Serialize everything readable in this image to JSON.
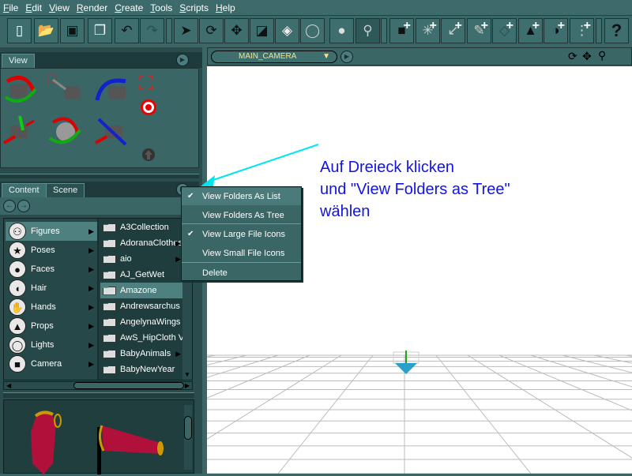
{
  "menubar": [
    "File",
    "Edit",
    "View",
    "Render",
    "Create",
    "Tools",
    "Scripts",
    "Help"
  ],
  "view_panel": {
    "tab": "View"
  },
  "content_panel": {
    "tabs": [
      "Content",
      "Scene"
    ],
    "categories": [
      {
        "label": "Figures",
        "icon": "figure-icon",
        "selected": true
      },
      {
        "label": "Poses",
        "icon": "pose-icon"
      },
      {
        "label": "Faces",
        "icon": "face-icon"
      },
      {
        "label": "Hair",
        "icon": "hair-icon"
      },
      {
        "label": "Hands",
        "icon": "hand-icon"
      },
      {
        "label": "Props",
        "icon": "props-icon"
      },
      {
        "label": "Lights",
        "icon": "lightbulb-icon"
      },
      {
        "label": "Camera",
        "icon": "camera-icon"
      }
    ],
    "folders": [
      {
        "label": "A3Collection",
        "sub": false
      },
      {
        "label": "AdoranaClothes",
        "sub": true
      },
      {
        "label": "aio",
        "sub": true
      },
      {
        "label": "AJ_GetWet",
        "sub": false
      },
      {
        "label": "Amazone",
        "sub": false,
        "selected": true
      },
      {
        "label": "Andrewsarchus",
        "sub": false
      },
      {
        "label": "AngelynaWings",
        "sub": false
      },
      {
        "label": "AwS_HipCloth V",
        "sub": false
      },
      {
        "label": "BabyAnimals",
        "sub": true
      },
      {
        "label": "BabyNewYear",
        "sub": false
      }
    ]
  },
  "viewport": {
    "camera": "MAIN_CAMERA"
  },
  "popup_menu": [
    {
      "label": "View Folders As List",
      "checked": true
    },
    {
      "label": "View Folders As Tree",
      "checked": false
    },
    {
      "label": "View Large File Icons",
      "checked": true
    },
    {
      "label": "View Small File Icons",
      "checked": false
    },
    {
      "label": "Delete",
      "checked": false
    }
  ],
  "annotation": {
    "line1": "Auf Dreieck klicken",
    "line2": "und \"View Folders as Tree\"",
    "line3": "wählen",
    "color": "#1414e0"
  }
}
